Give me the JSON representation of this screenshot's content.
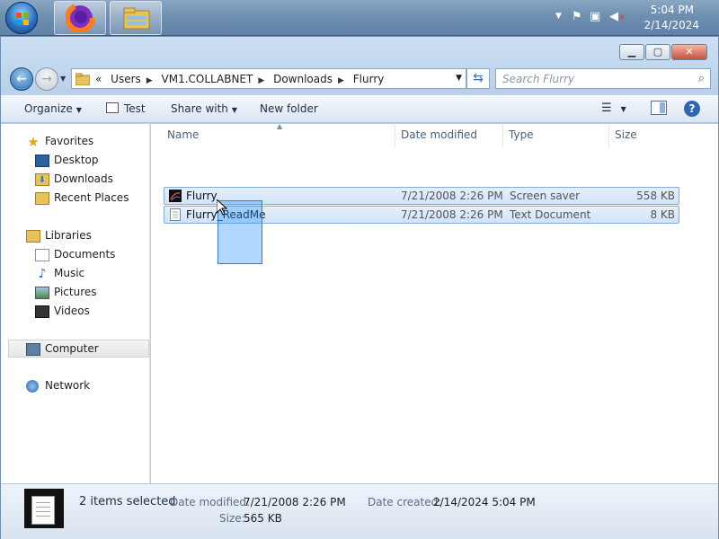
{
  "taskbar": {
    "clock_time": "5:04 PM",
    "clock_date": "2/14/2024",
    "apps": [
      "firefox-icon",
      "explorer-icon"
    ]
  },
  "window": {
    "address": {
      "overflow": "«",
      "crumbs": [
        "Users",
        "VM1.COLLABNET",
        "Downloads",
        "Flurry"
      ]
    },
    "search_placeholder": "Search Flurry",
    "toolbar": {
      "organize": "Organize",
      "test": "Test",
      "share_with": "Share with",
      "new_folder": "New folder"
    },
    "nav": {
      "favorites": "Favorites",
      "desktop": "Desktop",
      "downloads": "Downloads",
      "recent_places": "Recent Places",
      "libraries": "Libraries",
      "documents": "Documents",
      "music": "Music",
      "pictures": "Pictures",
      "videos": "Videos",
      "computer": "Computer",
      "network": "Network"
    },
    "columns": [
      "Name",
      "Date modified",
      "Type",
      "Size"
    ],
    "files": [
      {
        "name": "Flurry",
        "date": "7/21/2008 2:26 PM",
        "type": "Screen saver",
        "size": "558 KB",
        "icon": "screensaver-icon"
      },
      {
        "name": "Flurry_ReadMe",
        "date": "7/21/2008 2:26 PM",
        "type": "Text Document",
        "size": "8 KB",
        "icon": "text-file-icon"
      }
    ],
    "details": {
      "count": "2 items selected",
      "date_modified_label": "Date modified:",
      "date_modified": "7/21/2008 2:26 PM",
      "size_label": "Size:",
      "size": "565 KB",
      "date_created_label": "Date created:",
      "date_created": "2/14/2024 5:04 PM"
    }
  },
  "colors": {
    "selection_bg": "#d0e4f8",
    "selection_border": "#84acdd",
    "taskbar": "#6f8fb0"
  }
}
